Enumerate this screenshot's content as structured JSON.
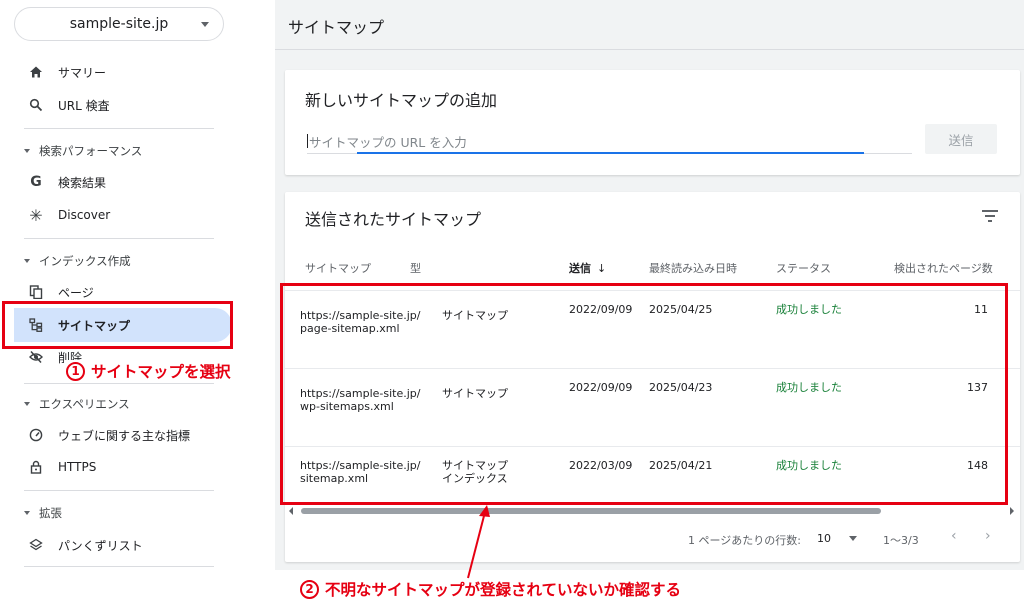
{
  "sidebar": {
    "property": "sample-site.jp",
    "items": {
      "summary": "サマリー",
      "url_inspection": "URL 検査",
      "search_results": "検索結果",
      "discover": "Discover",
      "pages": "ページ",
      "sitemaps": "サイトマップ",
      "removals": "削除",
      "core_web_vitals": "ウェブに関する主な指標",
      "https": "HTTPS",
      "breadcrumbs": "パンくずリスト"
    },
    "sections": {
      "performance": "検索パフォーマンス",
      "indexing": "インデックス作成",
      "experience": "エクスペリエンス",
      "enhancements": "拡張"
    }
  },
  "header": {
    "title": "サイトマップ"
  },
  "add_card": {
    "title": "新しいサイトマップの追加",
    "placeholder": "サイトマップの URL を入力",
    "submit": "送信"
  },
  "submitted_card": {
    "title": "送信されたサイトマップ",
    "columns": {
      "sitemap": "サイトマップ",
      "type": "型",
      "submitted": "送信",
      "last_read": "最終読み込み日時",
      "status": "ステータス",
      "discovered": "検出されたページ数"
    },
    "rows": [
      {
        "url1": "https://sample-site.jp/",
        "url2": "page-sitemap.xml",
        "type1": "サイトマップ",
        "type2": "",
        "submitted": "2022/09/09",
        "last_read": "2025/04/25",
        "status": "成功しました",
        "discovered": "11"
      },
      {
        "url1": "https://sample-site.jp/",
        "url2": "wp-sitemaps.xml",
        "type1": "サイトマップ",
        "type2": "",
        "submitted": "2022/09/09",
        "last_read": "2025/04/23",
        "status": "成功しました",
        "discovered": "137"
      },
      {
        "url1": "https://sample-site.jp/",
        "url2": "sitemap.xml",
        "type1": "サイトマップ",
        "type2": "インデックス",
        "submitted": "2022/03/09",
        "last_read": "2025/04/21",
        "status": "成功しました",
        "discovered": "148"
      }
    ],
    "pagination": {
      "rows_per_page_label": "1 ページあたりの行数:",
      "rows_per_page": "10",
      "range": "1〜3/3",
      "prev": "‹",
      "next": "›"
    }
  },
  "annotations": {
    "one_num": "1",
    "one_text": "サイトマップを選択",
    "two_num": "2",
    "two_text": "不明なサイトマップが登録されていないか確認する",
    "color": "#e60012"
  },
  "colors": {
    "accent": "#1a73e8",
    "active_bg": "#d2e3fc",
    "success": "#188038"
  }
}
